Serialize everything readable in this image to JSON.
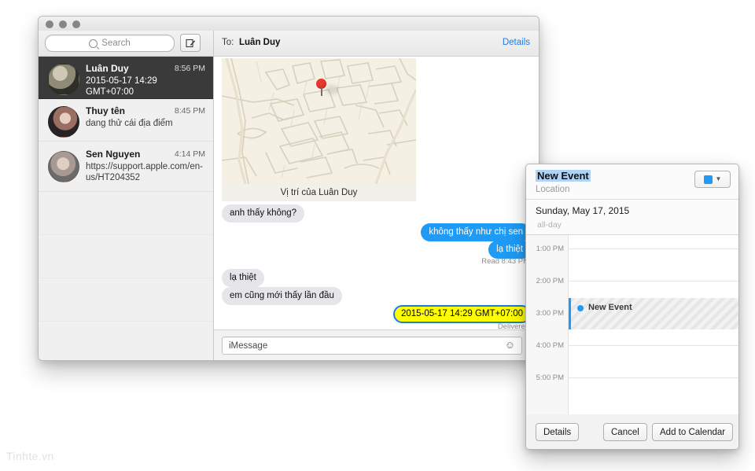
{
  "watermark": "Tinhte.vn",
  "messages_window": {
    "traffic_lights": [
      "close",
      "minimize",
      "zoom"
    ],
    "sidebar": {
      "search": {
        "placeholder": "Search",
        "icon": "search-icon"
      },
      "compose": {
        "icon": "compose-icon",
        "label": ""
      },
      "conversations": [
        {
          "name": "Luân Duy",
          "time": "8:56 PM",
          "snippet": "2015-05-17 14:29 GMT+07:00",
          "selected": true
        },
        {
          "name": "Thuy tên",
          "time": "8:45 PM",
          "snippet": "dang thử cái  địa điểm",
          "selected": false
        },
        {
          "name": "Sen Nguyen",
          "time": "4:14 PM",
          "snippet": "https://support.apple.com/en-us/HT204352",
          "selected": false
        }
      ]
    },
    "thread": {
      "to_label": "To:",
      "to_name": "Luân Duy",
      "details_link": "Details",
      "map": {
        "caption": "Vị trí của Luân Duy",
        "pin": "map-pin-icon"
      },
      "bubbles": [
        {
          "text": "anh thấy không?",
          "side": "in",
          "style": "normal"
        },
        {
          "text": "không thấy như chị sen",
          "side": "out",
          "style": "normal"
        },
        {
          "text": "lạ thiệt",
          "side": "out",
          "style": "normal"
        },
        {
          "text": "lạ thiệt",
          "side": "in",
          "style": "normal"
        },
        {
          "text": "em cũng mới thấy lần đầu",
          "side": "in",
          "style": "normal"
        },
        {
          "text": "2015-05-17 14:29 GMT+07:00",
          "side": "out",
          "style": "highlighted"
        }
      ],
      "status_read": "Read 8:43 PM",
      "status_delivered": "Delivered",
      "input": {
        "placeholder": "iMessage",
        "emoji_icon": "smiley-icon",
        "mic_icon": "microphone-icon"
      }
    }
  },
  "event_popover": {
    "title": "New Event",
    "location_placeholder": "Location",
    "calendar_color": "#1f9bf5",
    "date": "Sunday, May 17, 2015",
    "all_day": "all-day",
    "hours": [
      "1:00 PM",
      "2:00 PM",
      "3:00 PM",
      "4:00 PM",
      "5:00 PM"
    ],
    "event_block_label": "New Event",
    "buttons": {
      "details": "Details",
      "cancel": "Cancel",
      "add": "Add to Calendar"
    }
  }
}
